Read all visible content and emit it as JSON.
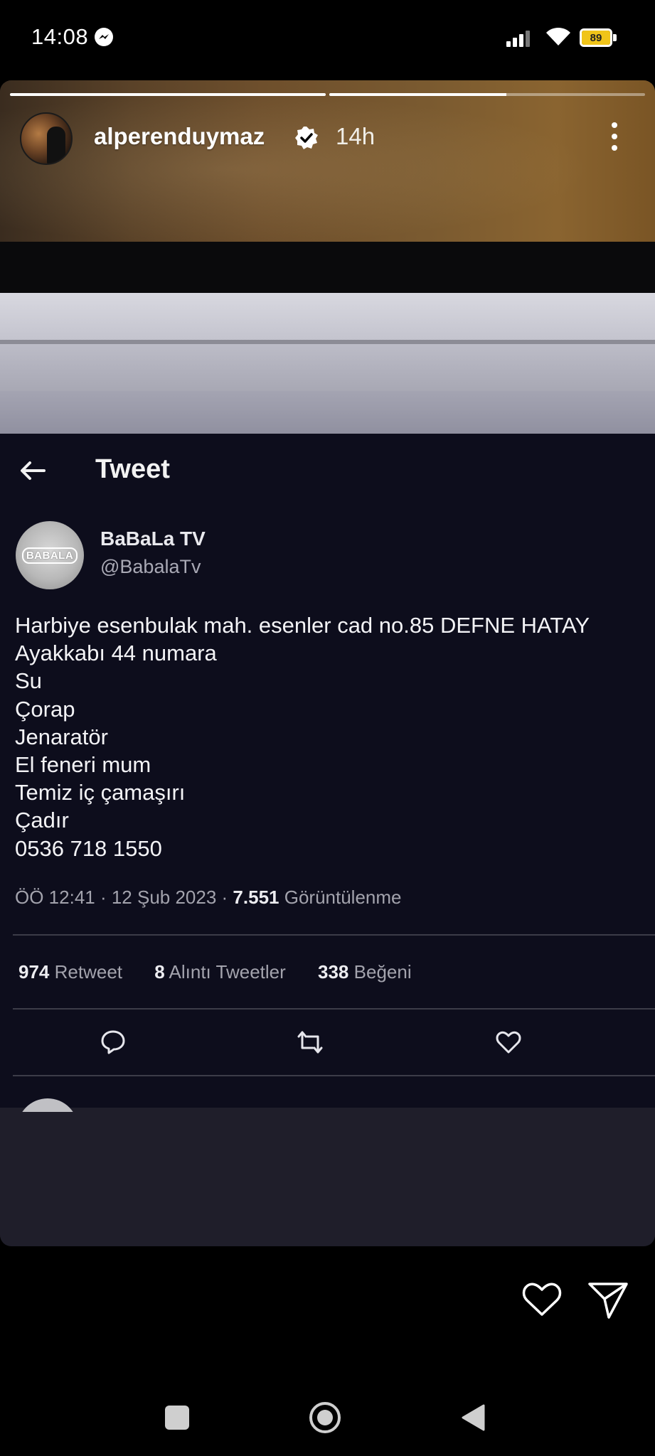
{
  "status_bar": {
    "time": "14:08",
    "battery_level": "89",
    "battery_color": "#f0c419",
    "icons": [
      "messenger-icon",
      "signal-icon",
      "wifi-icon",
      "battery-icon"
    ]
  },
  "story": {
    "progress": [
      1.0,
      0.56
    ],
    "username": "alperenduymaz",
    "verified": true,
    "time_ago": "14h"
  },
  "tweet": {
    "header_title": "Tweet",
    "author_name": "BaBaLa TV",
    "author_handle": "@BabalaTv",
    "avatar_logo": "BABALA",
    "body": "Harbiye esenbulak mah. esenler cad no.85 DEFNE HATAY\nAyakkabı 44 numara\nSu\nÇorap\nJenaratör\nEl feneri mum\nTemiz iç çamaşırı\nÇadır\n0536 718 1550",
    "time": "ÖÖ 12:41",
    "date": "12 Şub 2023",
    "views": "7.551",
    "views_label": "Görüntülenme",
    "retweets": "974",
    "retweets_label": "Retweet",
    "quotes": "8",
    "quotes_label": "Alıntı Tweetler",
    "likes": "338",
    "likes_label": "Beğeni"
  },
  "footer": {
    "icons": [
      "heart-icon",
      "send-icon"
    ]
  },
  "nav": {
    "icons": [
      "recents-square-icon",
      "home-circle-icon",
      "back-triangle-icon"
    ]
  }
}
